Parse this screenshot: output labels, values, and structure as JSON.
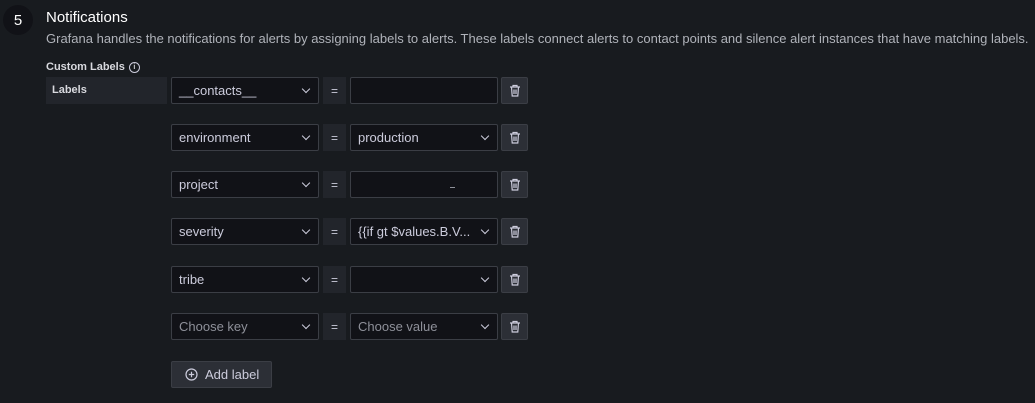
{
  "section": {
    "step_number": "5",
    "title": "Notifications",
    "description": "Grafana handles the notifications for alerts by assigning labels to alerts. These labels connect alerts to contact points and silence alert instances that have matching labels."
  },
  "custom_labels": {
    "heading": "Custom Labels",
    "info_icon": "info-circle-icon",
    "tag": "Labels",
    "operator": "=",
    "rows": [
      {
        "key": "__contacts__",
        "value": "",
        "value_kind": "input"
      },
      {
        "key": "environment",
        "value": "production",
        "value_kind": "select"
      },
      {
        "key": "project",
        "value": "",
        "value_kind": "input"
      },
      {
        "key": "severity",
        "value": "{{if gt $values.B.V...",
        "value_kind": "select"
      },
      {
        "key": "tribe",
        "value": "",
        "value_kind": "select"
      },
      {
        "key": "",
        "key_placeholder": "Choose key",
        "value": "",
        "value_placeholder": "Choose value",
        "value_kind": "select"
      }
    ],
    "delete_icon": "trash-icon",
    "add_label": "Add label",
    "add_icon": "plus-circle-icon"
  }
}
